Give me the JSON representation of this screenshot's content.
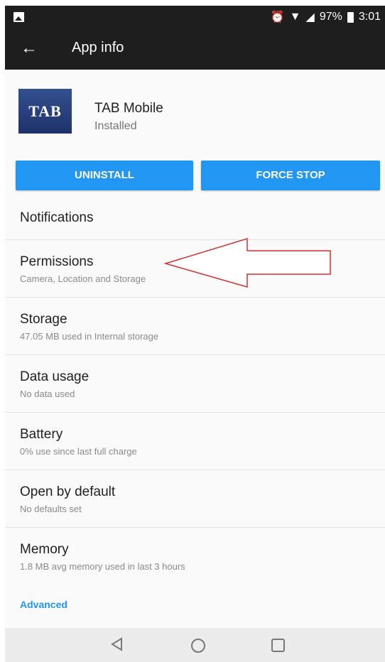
{
  "status_bar": {
    "battery_percent": "97%",
    "time": "3:01",
    "icons": [
      "image-icon",
      "alarm-icon",
      "wifi-icon",
      "signal-icon",
      "battery-charging-icon"
    ]
  },
  "app_bar": {
    "title": "App info",
    "back_icon": "arrow-left-icon"
  },
  "app": {
    "logo_text": "TAB",
    "name": "TAB Mobile",
    "status": "Installed"
  },
  "buttons": {
    "uninstall": "UNINSTALL",
    "force_stop": "FORCE STOP"
  },
  "settings": {
    "notifications": {
      "title": "Notifications"
    },
    "permissions": {
      "title": "Permissions",
      "subtitle": "Camera, Location and Storage"
    },
    "storage": {
      "title": "Storage",
      "subtitle": "47.05 MB used in Internal storage"
    },
    "data_usage": {
      "title": "Data usage",
      "subtitle": "No data used"
    },
    "battery": {
      "title": "Battery",
      "subtitle": "0% use since last full charge"
    },
    "open_by_default": {
      "title": "Open by default",
      "subtitle": "No defaults set"
    },
    "memory": {
      "title": "Memory",
      "subtitle": "1.8 MB avg memory used in last 3 hours"
    }
  },
  "advanced_label": "Advanced",
  "colors": {
    "accent": "#2196f3",
    "toolbar": "#1e1e1e",
    "annotation": "#d32f2f"
  }
}
